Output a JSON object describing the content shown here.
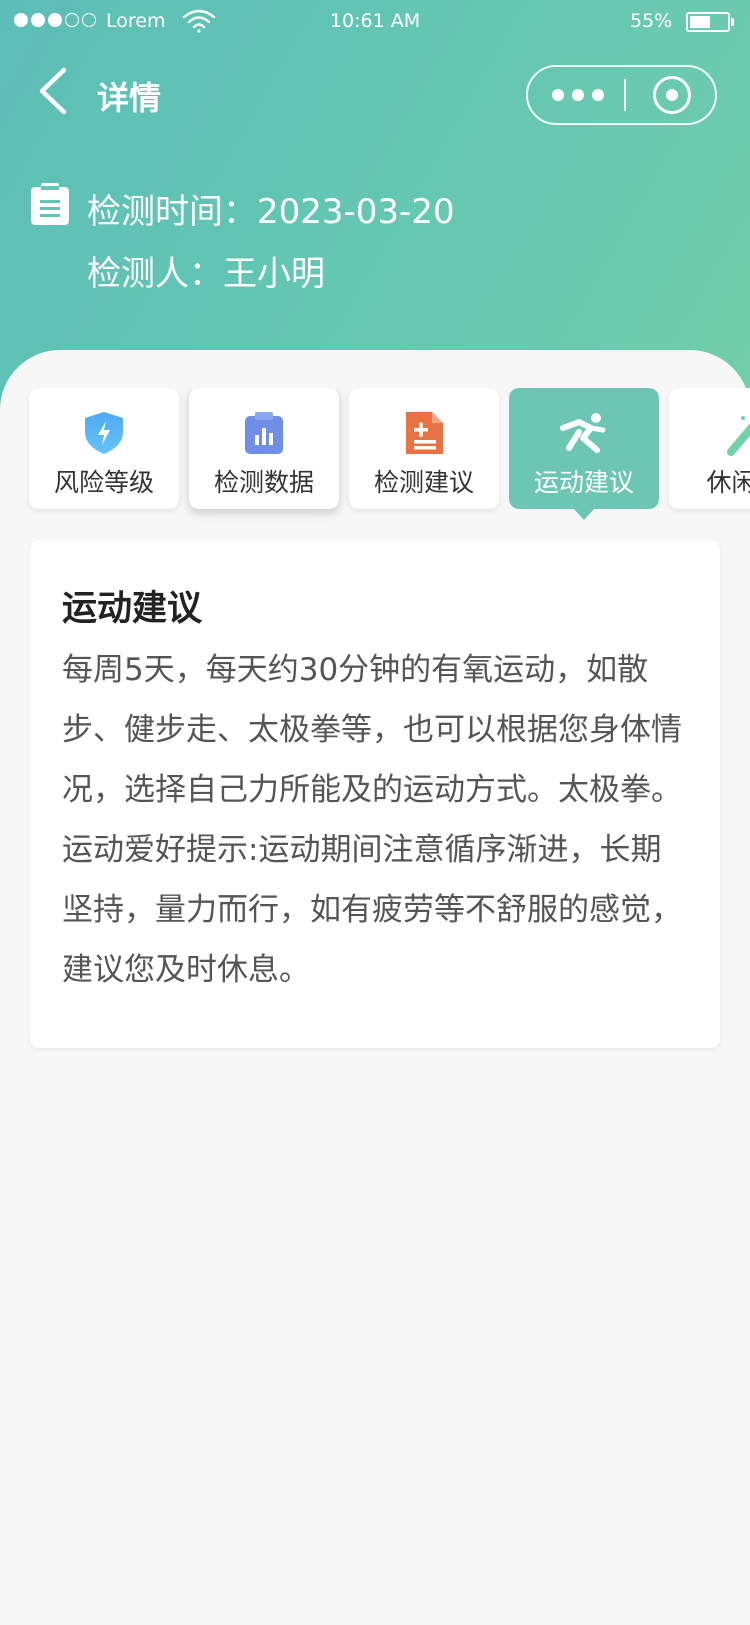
{
  "status_bar": {
    "carrier": "Lorem",
    "time": "10:61 AM",
    "battery_percent": "55%",
    "battery_level": 0.55,
    "signal_bars_filled": 3,
    "signal_bars_total": 5
  },
  "nav": {
    "title": "详情",
    "back_icon": "chevron-left-icon",
    "more_icon": "more-dots-icon",
    "close_icon": "target-close-icon"
  },
  "info": {
    "date_label": "检测时间：2023-03-20",
    "person_label": "检测人：王小明",
    "icon": "clipboard-icon"
  },
  "tabs": [
    {
      "label": "风险等级",
      "icon": "shield-bolt-icon",
      "active": false
    },
    {
      "label": "检测数据",
      "icon": "clipboard-chart-icon",
      "active": false
    },
    {
      "label": "检测建议",
      "icon": "document-plus-icon",
      "active": false
    },
    {
      "label": "运动建议",
      "icon": "running-icon",
      "active": true
    },
    {
      "label": "休闲娱",
      "icon": "wand-icon",
      "active": false
    }
  ],
  "card": {
    "title": "运动建议",
    "body": "每周5天，每天约30分钟的有氧运动，如散步、健步走、太极拳等，也可以根据您身体情况，选择自己力所能及的运动方式。太极拳。运动爱好提示:运动期间注意循序渐进，长期坚持，量力而行，如有疲劳等不舒服的感觉，建议您及时休息。"
  },
  "colors": {
    "header_start": "#5dbdb8",
    "header_end": "#72ceab",
    "active_tab": "#6dc6b4",
    "page_bg": "#f7f7f7"
  }
}
